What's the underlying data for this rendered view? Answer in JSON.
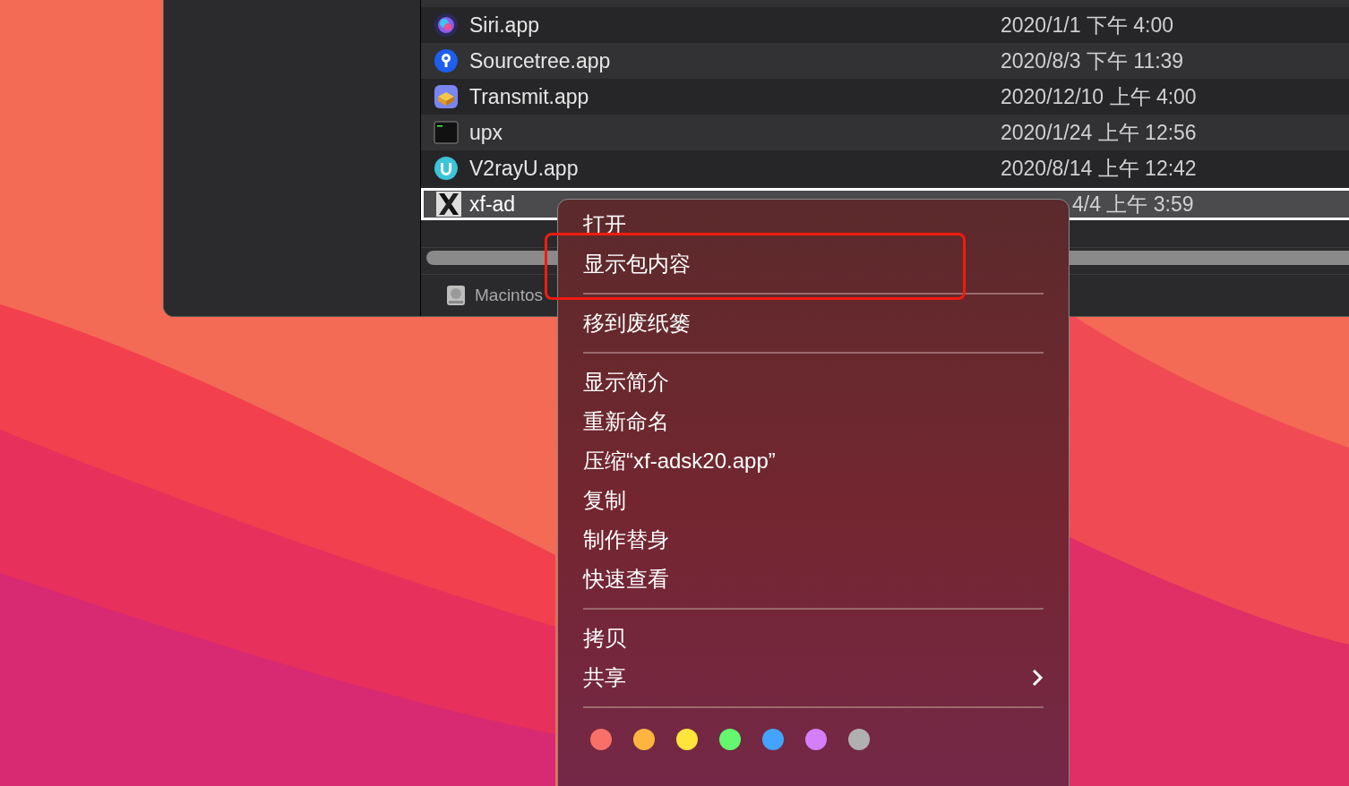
{
  "finder": {
    "rows": [
      {
        "name": "Siri.app",
        "date": "2020/1/1 下午 4:00",
        "selected": false
      },
      {
        "name": "Sourcetree.app",
        "date": "2020/8/3 下午 11:39",
        "selected": false
      },
      {
        "name": "Transmit.app",
        "date": "2020/12/10 上午 4:00",
        "selected": false
      },
      {
        "name": "upx",
        "date": "2020/1/24 上午 12:56",
        "selected": false
      },
      {
        "name": "V2rayU.app",
        "date": "2020/8/14 上午 12:42",
        "selected": false
      },
      {
        "name": "xf-ad",
        "date": "4/4 上午 3:59",
        "selected": true
      }
    ],
    "path_bar": {
      "disk": "Macintos"
    }
  },
  "context_menu": {
    "sections": [
      [
        {
          "label": "打开",
          "annotated": false,
          "submenu": false
        },
        {
          "label": "显示包内容",
          "annotated": true,
          "submenu": false
        }
      ],
      [
        {
          "label": "移到废纸篓",
          "annotated": false,
          "submenu": false
        }
      ],
      [
        {
          "label": "显示简介",
          "annotated": false,
          "submenu": false
        },
        {
          "label": "重新命名",
          "annotated": false,
          "submenu": false
        },
        {
          "label": "压缩“xf-adsk20.app”",
          "annotated": false,
          "submenu": false
        },
        {
          "label": "复制",
          "annotated": false,
          "submenu": false
        },
        {
          "label": "制作替身",
          "annotated": false,
          "submenu": false
        },
        {
          "label": "快速查看",
          "annotated": false,
          "submenu": false
        }
      ],
      [
        {
          "label": "拷贝",
          "annotated": false,
          "submenu": false
        },
        {
          "label": "共享",
          "annotated": false,
          "submenu": true
        }
      ]
    ],
    "tags": [
      {
        "color": "#f87068"
      },
      {
        "color": "#fdb540"
      },
      {
        "color": "#fde53c"
      },
      {
        "color": "#63f870"
      },
      {
        "color": "#43a3fd"
      },
      {
        "color": "#d47efb"
      },
      {
        "color": "#b0b0b0"
      }
    ]
  }
}
